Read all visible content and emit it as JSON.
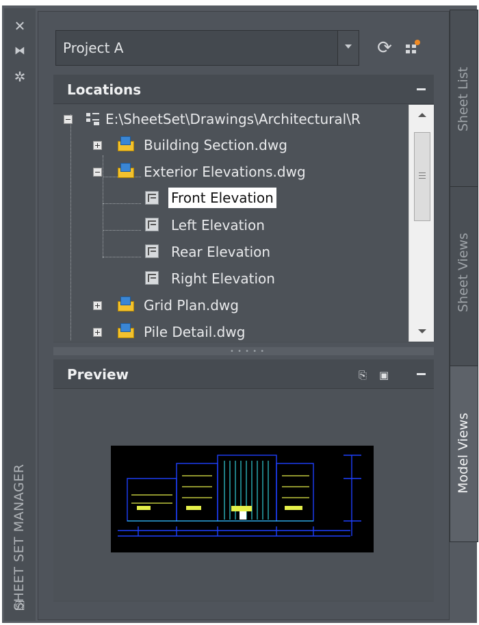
{
  "palette": {
    "title": "SHEET SET MANAGER"
  },
  "strip_icons": [
    "close-icon",
    "auto-hide-icon",
    "properties-icon",
    "sheetset-icon"
  ],
  "project_select": {
    "value": "Project A"
  },
  "toolbar": {
    "refresh_icon": "refresh-icon",
    "new_sheet_icon": "model-view-icon"
  },
  "locations": {
    "header": "Locations",
    "root": "E:\\SheetSet\\Drawings\\Architectural\\R",
    "items": [
      {
        "label": "Building Section.dwg",
        "expanded": false
      },
      {
        "label": "Exterior Elevations.dwg",
        "expanded": true
      },
      {
        "label": "Front Elevation",
        "selected": true
      },
      {
        "label": "Left Elevation"
      },
      {
        "label": "Rear Elevation"
      },
      {
        "label": "Right Elevation"
      },
      {
        "label": "Grid Plan.dwg",
        "expanded": false
      },
      {
        "label": "Pile Detail.dwg",
        "expanded": false
      }
    ]
  },
  "preview": {
    "header": "Preview"
  },
  "tabs": [
    {
      "label": "Sheet List",
      "active": false
    },
    {
      "label": "Sheet Views",
      "active": false
    },
    {
      "label": "Model Views",
      "active": true
    }
  ],
  "colors": {
    "selected_bg": "#ffffff",
    "panel_bg": "#4f545b",
    "drawing_bg": "#000000",
    "drawing_lines": "#1e40ff"
  }
}
